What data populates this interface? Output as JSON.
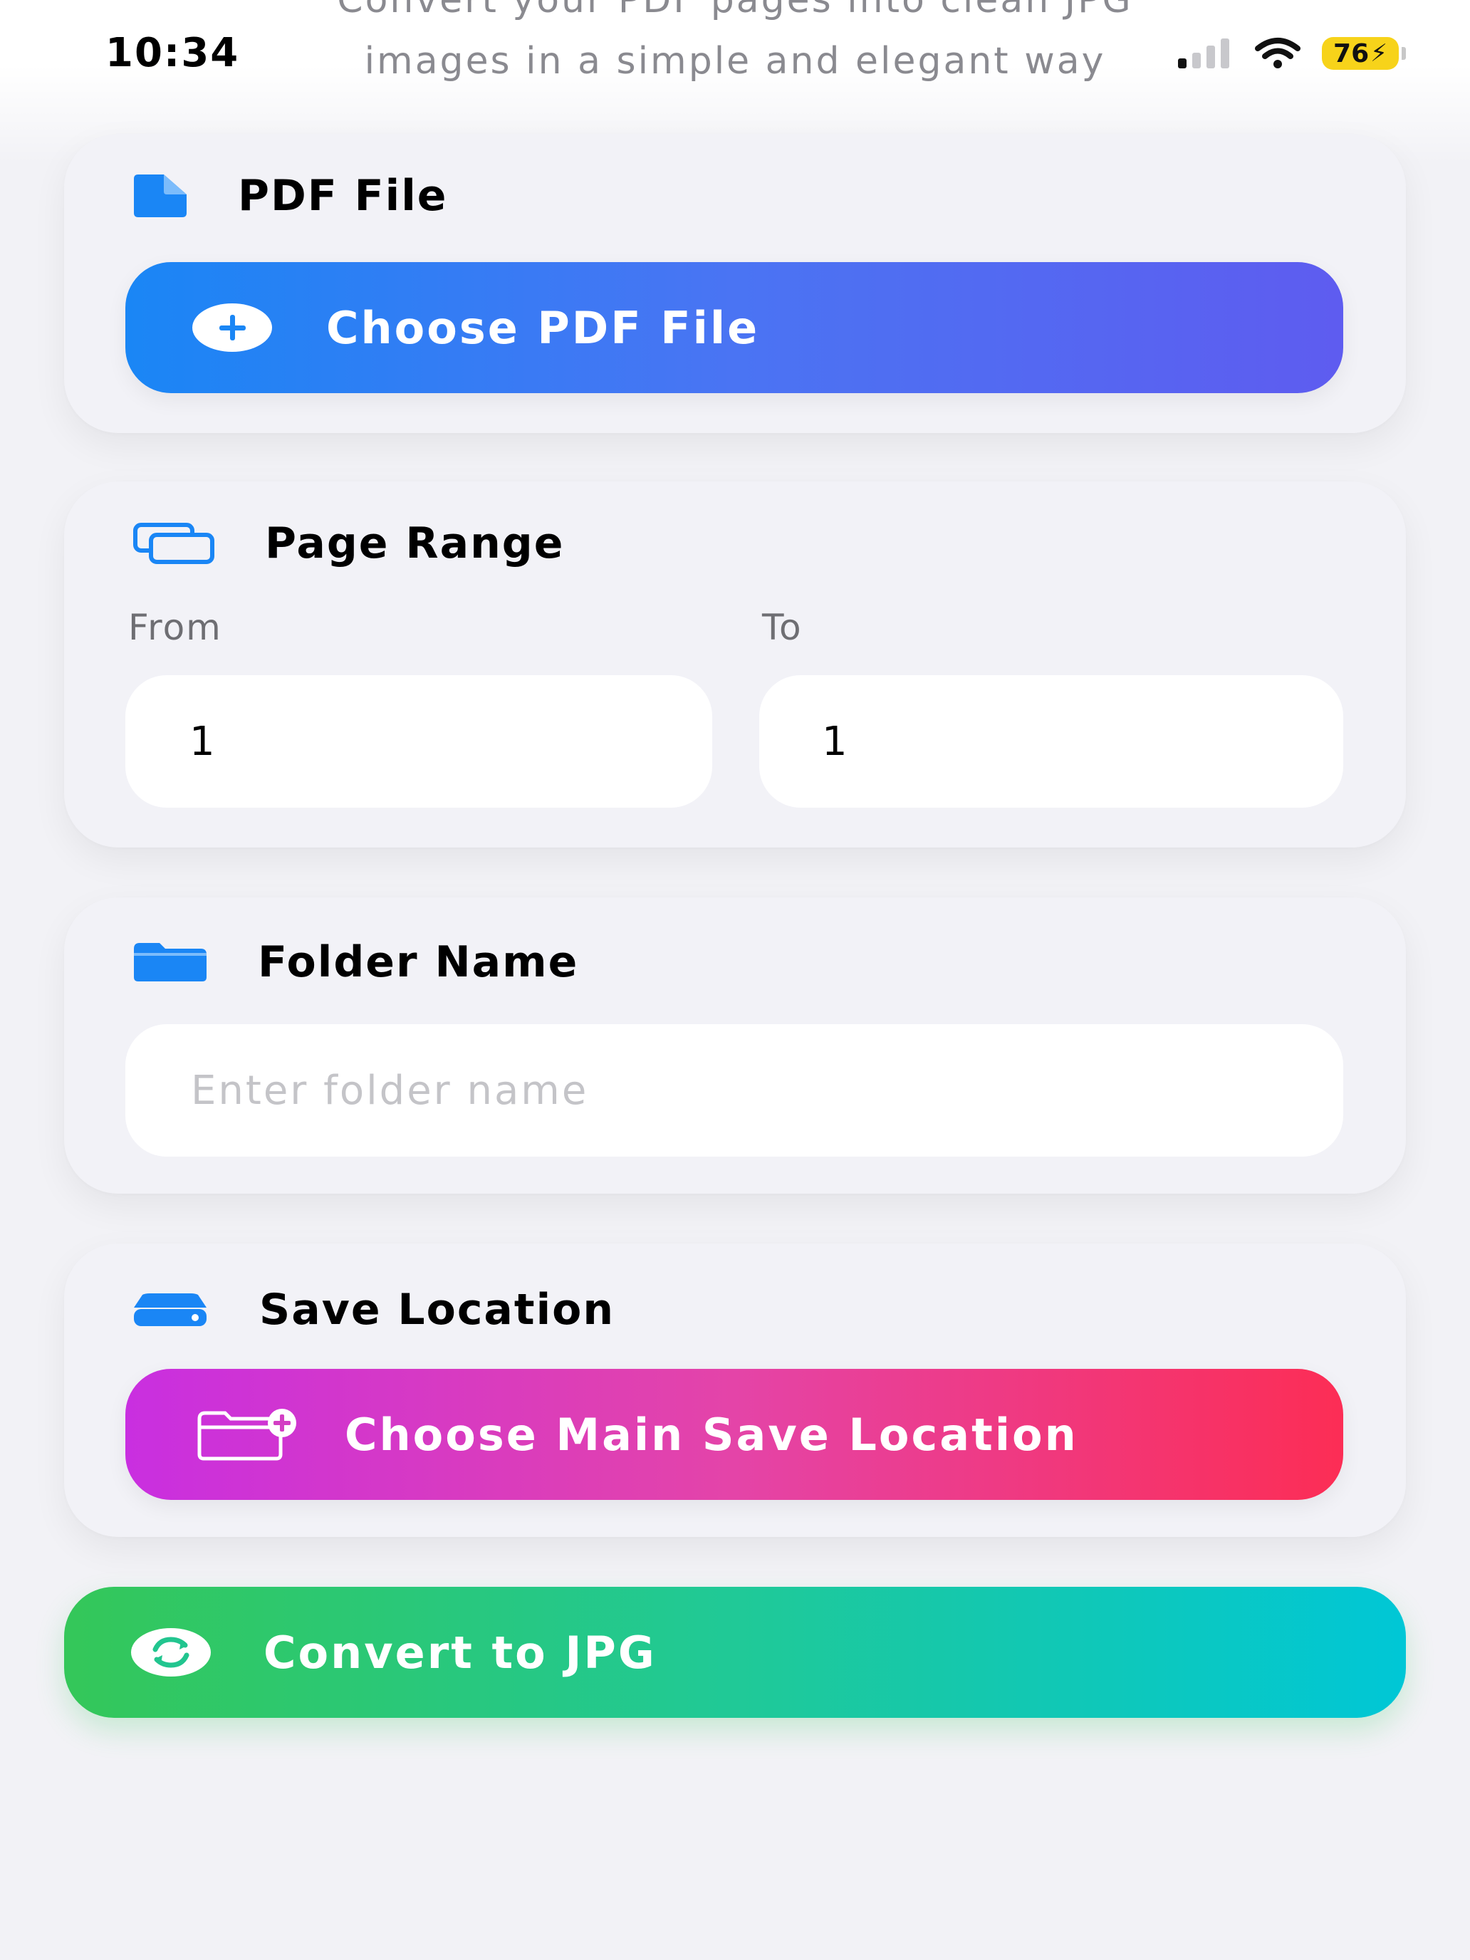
{
  "status_bar": {
    "time": "10:34",
    "battery": "76",
    "icons": [
      "cellular-signal-icon",
      "wifi-icon",
      "battery-charging-icon"
    ]
  },
  "header": {
    "subtitle_line1": "Convert your PDF pages into clean JPG",
    "subtitle_line2": "images in a simple and elegant way"
  },
  "pdf_file": {
    "title": "PDF File",
    "icon": "document-icon",
    "button_label": "Choose PDF File",
    "button_icon": "plus-circle-icon",
    "gradient": [
      "#1a86f5",
      "#5e5cf0"
    ]
  },
  "page_range": {
    "title": "Page Range",
    "icon": "pages-stack-icon",
    "from_label": "From",
    "to_label": "To",
    "from_value": "1",
    "to_value": "1"
  },
  "folder_name": {
    "title": "Folder Name",
    "icon": "folder-icon",
    "placeholder": "Enter folder name",
    "value": ""
  },
  "save_location": {
    "title": "Save Location",
    "icon": "drive-icon",
    "button_label": "Choose Main Save Location",
    "button_icon": "folder-plus-icon",
    "gradient": [
      "#c92fe0",
      "#fc2d55"
    ]
  },
  "convert": {
    "label": "Convert to JPG",
    "icon": "refresh-circle-icon",
    "gradient": [
      "#34c759",
      "#00c7d6"
    ]
  },
  "colors": {
    "accent": "#1a86f5",
    "background": "#f2f2f6"
  }
}
